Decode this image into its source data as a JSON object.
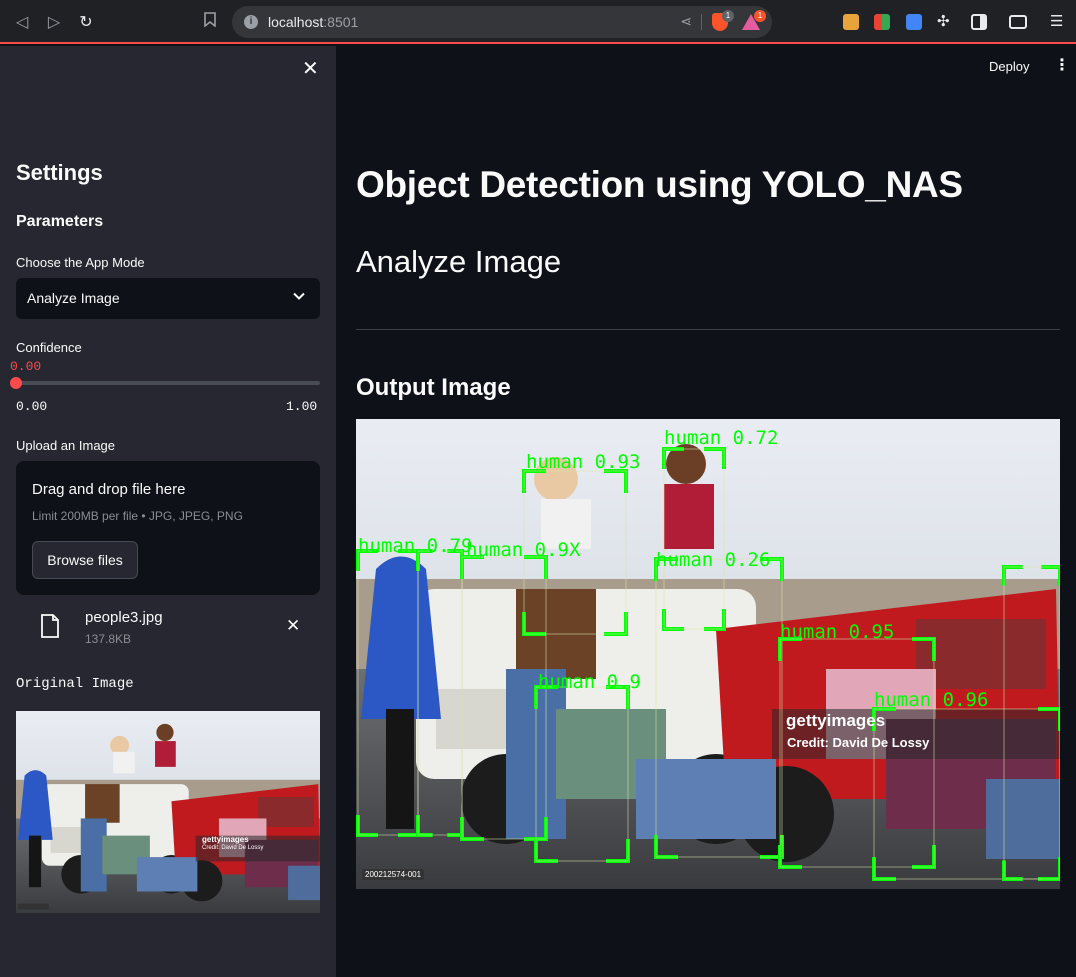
{
  "browser": {
    "url_host": "localhost",
    "url_port": ":8501",
    "brave_badge": "1",
    "rewards_badge": "1"
  },
  "sidebar": {
    "title": "Settings",
    "params_heading": "Parameters",
    "mode_label": "Choose the App Mode",
    "mode_value": "Analyze Image",
    "confidence_label": "Confidence",
    "confidence_value": "0.00",
    "confidence_fraction": 0.0,
    "slider_min": "0.00",
    "slider_max": "1.00",
    "upload_label": "Upload an Image",
    "dropzone_title": "Drag and drop file here",
    "dropzone_limit": "Limit 200MB per file • JPG, JPEG, PNG",
    "browse_label": "Browse files",
    "file_name": "people3.jpg",
    "file_size": "137.8KB",
    "original_label": "Original Image"
  },
  "header": {
    "deploy_label": "Deploy"
  },
  "main": {
    "title": "Object Detection using YOLO_NAS",
    "subtitle": "Analyze Image",
    "output_heading": "Output Image"
  },
  "image": {
    "watermark": "gettyimages",
    "credit": "Credit: David De Lossy",
    "image_id": "200212574-001"
  },
  "detections": [
    {
      "label": "human 0.72"
    },
    {
      "label": "human 0.93"
    },
    {
      "label": "human 0.79"
    },
    {
      "label": "human 0.9X"
    },
    {
      "label": "human 0.26"
    },
    {
      "label": "human 0.95"
    },
    {
      "label": "human 0.9"
    },
    {
      "label": "human 0.96"
    }
  ],
  "colors": {
    "accent": "#ff4b4b",
    "box": "#00ff00",
    "sidebar_bg": "#262730",
    "main_bg": "#0e1117"
  }
}
